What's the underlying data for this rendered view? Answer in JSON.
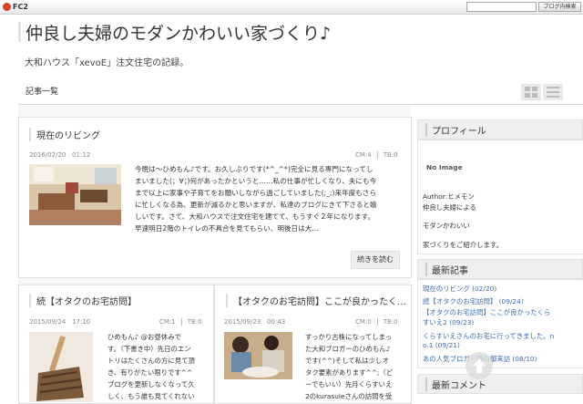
{
  "fc2": {
    "logo": "FC2",
    "search_button": "ブログ内検索",
    "search_value": ""
  },
  "header": {
    "title": "仲良し夫婦のモダンかわいい家づくり♪",
    "subtitle": "大和ハウス「xevoE」注文住宅の記録。"
  },
  "nav": {
    "tab_label": "記事一覧"
  },
  "featured": {
    "title": "現在のリビング",
    "date": "2016/02/20",
    "time": "01:12",
    "cm": "CM:4",
    "tb": "TB:0",
    "excerpt_lines": [
      "今晩は〜ひめもん♪です。お久しぶりです(*^_^*)完全に見る専門になってし",
      "まいました(；∀；)何があったかというと……私の仕事が忙しくなり、夫にも今",
      "まで以上に家事や子育てをお願いしながら過ごしていました(;_;)来年度もさら",
      "に忙しくなる為、更新が減るかと思いますが、私達のブログにきて下さると嬉",
      "しいです。さて、大和ハウスで注文住宅を建てて、もうすぐ２年になります。",
      "早速明日2階のトイレの不具合を見てもらい、明後日は大..."
    ],
    "read_more": "続きを読む"
  },
  "posts": [
    {
      "title": "続【オタクのお宅訪問】",
      "date": "2015/09/24",
      "time": "17:10",
      "cm": "CM:1",
      "tb": "TB:0",
      "excerpt_lines": [
        "ひめもん♪ @お昼休みで",
        "す。（下書き中）先日のエン",
        "トリはたくさんの方に見て頂",
        "き、有りがたい限りです^^",
        "ブログを更新しなくなって久",
        "しく、もう誰も見てくれない"
      ]
    },
    {
      "title": "【オタクのお宅訪問】ここが良かったく…",
      "date": "2015/09/23",
      "time": "00:43",
      "cm": "CM:0",
      "tb": "TB:0",
      "excerpt_lines": [
        "すっかり古株になってしまっ",
        "た大和ブロガーのひめもん♪",
        "です(^^)そして私は少しオ",
        "タク要素があります^^;（ど",
        "ーでもいい）先月くらすいえ",
        "2のkurasuieさんの訪問を受"
      ]
    }
  ],
  "sidebar": {
    "profile": {
      "heading": "プロフィール",
      "image_alt": "No Image",
      "author": "Author:ヒメモン",
      "lines": [
        "仲良し夫婦による",
        "モダンかわいい",
        "家づくりをご紹介します。"
      ]
    },
    "recent": {
      "heading": "最新記事",
      "items": [
        "現在のリビング (02/20)",
        "続【オタクのお宅訪問】 (09/24)",
        "【オタクのお宅訪問】ここが良かったくら",
        "すいえ2 (09/23)",
        "くらすいえさんのお宅に行ってきました。n",
        "o.1 (09/21)",
        "あの人気ブロガー様の御来訪 (08/10)"
      ]
    },
    "comments": {
      "heading": "最新コメント"
    }
  }
}
